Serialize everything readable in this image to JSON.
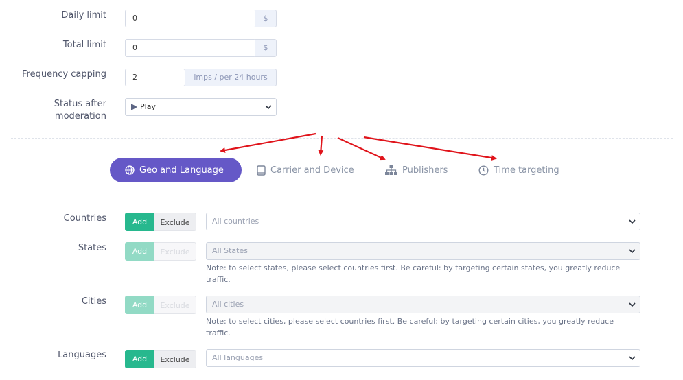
{
  "limits": {
    "daily": {
      "label": "Daily limit",
      "value": "0",
      "addon": "$"
    },
    "total": {
      "label": "Total limit",
      "value": "0",
      "addon": "$"
    },
    "frequency": {
      "label": "Frequency capping",
      "value": "2",
      "addon": "imps / per 24 hours"
    },
    "status": {
      "label_line1": "Status after",
      "label_line2": "moderation",
      "value": "Play"
    }
  },
  "tabs": [
    {
      "label": "Geo and Language",
      "icon": "globe-icon",
      "active": true
    },
    {
      "label": "Carrier and Device",
      "icon": "tablet-icon",
      "active": false
    },
    {
      "label": "Publishers",
      "icon": "sitemap-icon",
      "active": false
    },
    {
      "label": "Time targeting",
      "icon": "clock-icon",
      "active": false
    }
  ],
  "targeting": {
    "add_label": "Add",
    "exclude_label": "Exclude",
    "countries": {
      "label": "Countries",
      "placeholder": "All countries"
    },
    "states": {
      "label": "States",
      "placeholder": "All States",
      "note": "Note: to select states, please select countries first. Be careful: by targeting certain states, you greatly reduce traffic."
    },
    "cities": {
      "label": "Cities",
      "placeholder": "All cities",
      "note": "Note: to select cities, please select countries first. Be careful: by targeting certain cities, you greatly reduce traffic."
    },
    "languages": {
      "label": "Languages",
      "placeholder": "All languages"
    }
  },
  "colors": {
    "accent": "#6558c7",
    "add": "#27b88e",
    "arrow": "#e0141b"
  }
}
